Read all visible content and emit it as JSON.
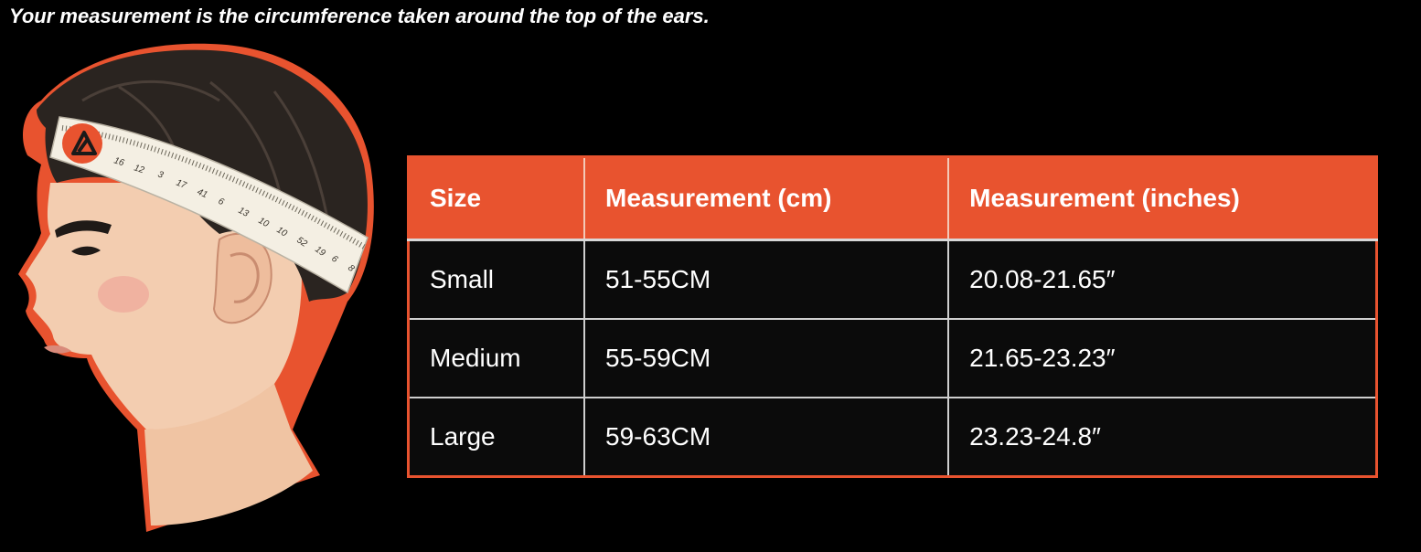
{
  "caption": "Your measurement is the circumference taken around the top of the ears.",
  "illustration": {
    "tape_numbers": [
      "16",
      "12",
      "3",
      "17",
      "41",
      "6",
      "13",
      "10",
      "10",
      "52",
      "19",
      "6",
      "8"
    ]
  },
  "table": {
    "headers": [
      "Size",
      "Measurement (cm)",
      "Measurement (inches)"
    ],
    "rows": [
      [
        "Small",
        "51-55CM",
        "20.08-21.65″"
      ],
      [
        "Medium",
        "55-59CM",
        "21.65-23.23″"
      ],
      [
        "Large",
        "59-63CM",
        "23.23-24.8″"
      ]
    ]
  },
  "colors": {
    "accent": "#e8532f",
    "background": "#000000",
    "row_background": "#0b0b0b",
    "text": "#ffffff"
  }
}
